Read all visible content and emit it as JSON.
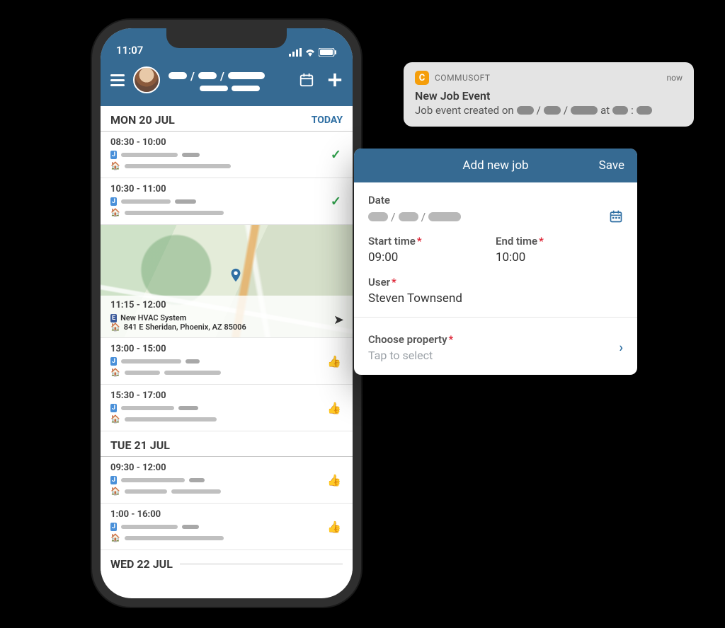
{
  "statusbar": {
    "time": "11:07"
  },
  "header": {
    "calendar_icon": "calendar",
    "plus_icon": "plus"
  },
  "days": [
    {
      "label": "MON 20 JUL",
      "today": "TODAY",
      "jobs": [
        {
          "time": "08:30 - 10:00",
          "status": "check"
        },
        {
          "time": "10:30 - 11:00",
          "status": "check"
        }
      ],
      "map_job": {
        "time": "11:15 - 12:00",
        "title": "New HVAC System",
        "address": "841 E Sheridan, Phoenix, AZ 85006"
      },
      "jobs_after": [
        {
          "time": "13:00 - 15:00",
          "status": "thumb"
        },
        {
          "time": "15:30 - 17:00",
          "status": "thumb"
        }
      ]
    },
    {
      "label": "TUE 21 JUL",
      "jobs": [
        {
          "time": "09:30 - 12:00",
          "status": "thumb"
        },
        {
          "time": "1:00 - 16:00",
          "status": "thumb"
        }
      ]
    },
    {
      "label": "WED 22 JUL",
      "jobs": []
    }
  ],
  "panel": {
    "title": "Add new job",
    "save": "Save",
    "date_label": "Date",
    "start_label": "Start time",
    "start_value": "09:00",
    "end_label": "End time",
    "end_value": "10:00",
    "user_label": "User",
    "user_value": "Steven Townsend",
    "property_label": "Choose property",
    "property_placeholder": "Tap to select"
  },
  "notification": {
    "app": "COMMUSOFT",
    "when": "now",
    "title": "New Job Event",
    "body_prefix": "Job event created on",
    "body_mid": "at"
  }
}
